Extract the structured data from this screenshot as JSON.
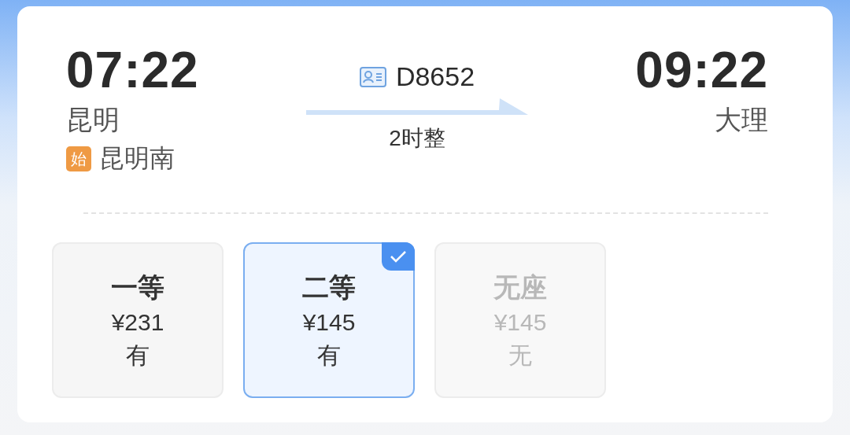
{
  "departure": {
    "time": "07:22",
    "city": "昆明",
    "badge": "始",
    "station": "昆明南"
  },
  "train": {
    "number": "D8652",
    "duration": "2时整"
  },
  "arrival": {
    "time": "09:22",
    "city": "大理"
  },
  "seats": [
    {
      "name": "一等",
      "price": "¥231",
      "availability": "有",
      "selected": false,
      "disabled": false
    },
    {
      "name": "二等",
      "price": "¥145",
      "availability": "有",
      "selected": true,
      "disabled": false
    },
    {
      "name": "无座",
      "price": "¥145",
      "availability": "无",
      "selected": false,
      "disabled": true
    }
  ]
}
